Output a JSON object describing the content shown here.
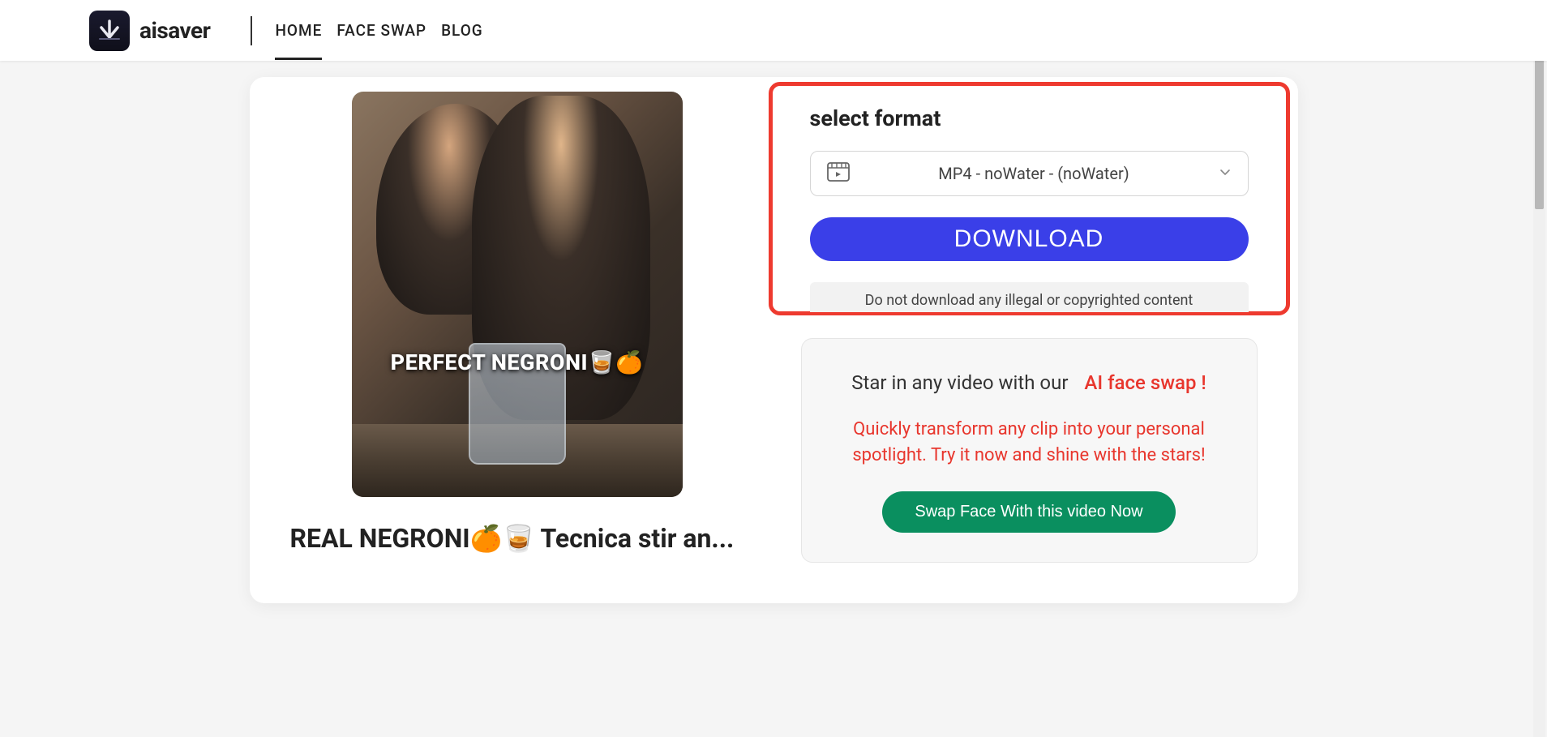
{
  "brand": {
    "name": "aisaver"
  },
  "nav": {
    "items": [
      {
        "label": "HOME",
        "active": true
      },
      {
        "label": "FACE SWAP",
        "active": false
      },
      {
        "label": "BLOG",
        "active": false
      }
    ]
  },
  "video": {
    "thumbnail_caption": "PERFECT NEGRONI🥃🍊",
    "title": "REAL NEGRONI🍊🥃 Tecnica stir an..."
  },
  "format_panel": {
    "heading": "select format",
    "selected": "MP4 - noWater - (noWater)",
    "download_label": "DOWNLOAD",
    "disclaimer": "Do not download any illegal or copyrighted content"
  },
  "promo": {
    "line1_plain": "Star in any video with our",
    "line1_highlight": "AI face swap !",
    "description": "Quickly transform any clip into your personal spotlight. Try it now and shine with the stars!",
    "button": "Swap Face With this video Now"
  }
}
